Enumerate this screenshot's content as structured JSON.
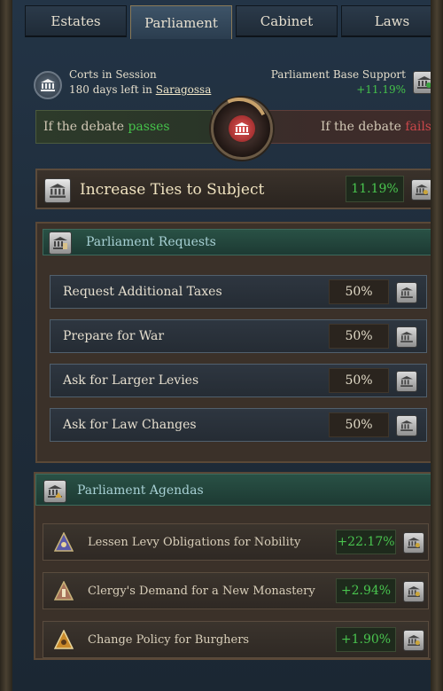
{
  "tabs": [
    {
      "label": "Estates",
      "active": false
    },
    {
      "label": "Parliament",
      "active": true
    },
    {
      "label": "Cabinet",
      "active": false
    },
    {
      "label": "Laws",
      "active": false
    }
  ],
  "session": {
    "line1": "Corts in Session",
    "days_left": "180 days left in ",
    "city": "Saragossa",
    "icon": "parliament-building-icon"
  },
  "base_support": {
    "label": "Parliament Base Support",
    "value": "+11.19%",
    "icon": "parliament-check-icon"
  },
  "debate": {
    "left_prefix": "If the debate ",
    "left_word": "passes",
    "right_prefix": "If the debate ",
    "right_word": "fails",
    "pass_color": "#45c24a",
    "fail_color": "#c8474a"
  },
  "proposal": {
    "name": "Increase Ties to Subject",
    "support": "11.19%",
    "icon": "parliament-columns-icon"
  },
  "requests": {
    "title": "Parliament Requests",
    "items": [
      {
        "label": "Request Additional Taxes",
        "value": "50%"
      },
      {
        "label": "Prepare for War",
        "value": "50%"
      },
      {
        "label": "Ask for Larger Levies",
        "value": "50%"
      },
      {
        "label": "Ask for Law Changes",
        "value": "50%"
      }
    ]
  },
  "agendas": {
    "title": "Parliament Agendas",
    "items": [
      {
        "label": "Lessen Levy Obligations for Nobility",
        "value": "+22.17%",
        "icon": "nobility-estate-icon"
      },
      {
        "label": "Clergy's Demand for a New Monastery",
        "value": "+2.94%",
        "icon": "clergy-estate-icon"
      },
      {
        "label": "Change Policy for Burghers",
        "value": "+1.90%",
        "icon": "burghers-estate-icon"
      }
    ]
  }
}
